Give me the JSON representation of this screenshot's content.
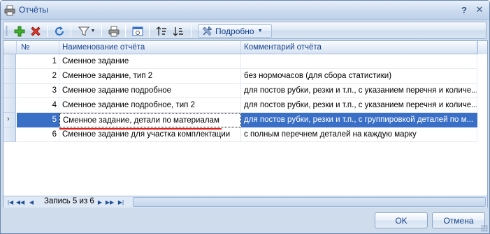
{
  "window": {
    "title": "Отчёты",
    "icon": "printer-icon"
  },
  "toolbar": {
    "view_dropdown_label": "Подробно"
  },
  "grid": {
    "columns": [
      "№",
      "Наименование отчёта",
      "Комментарий отчёта"
    ],
    "rows": [
      {
        "num": "1",
        "name": "Сменное задание",
        "comment": ""
      },
      {
        "num": "2",
        "name": "Сменное задание, тип 2",
        "comment": "без нормочасов (для сбора статистики)"
      },
      {
        "num": "3",
        "name": "Сменное задание подробное",
        "comment": "для постов рубки, резки и т.п., с указанием перечня и количе..."
      },
      {
        "num": "4",
        "name": "Сменное задание подробное, тип 2",
        "comment": "для постов рубки, резки и т.п., с указанием перечня и количе..."
      },
      {
        "num": "5",
        "name": "Сменное задание, детали по материалам",
        "comment": "для постов рубки, резки и т.п., с группировкой деталей по м..."
      },
      {
        "num": "6",
        "name": "Сменное задание для участка комплектации",
        "comment": "с полным перечнем деталей на каждую марку"
      }
    ],
    "selected_row": 5
  },
  "navigator": {
    "record_text": "Запись 5 из 6"
  },
  "buttons": {
    "ok": "OK",
    "cancel": "Отмена"
  },
  "colors": {
    "selection": "#3a6fc7",
    "accent_underline": "#e0201c"
  }
}
